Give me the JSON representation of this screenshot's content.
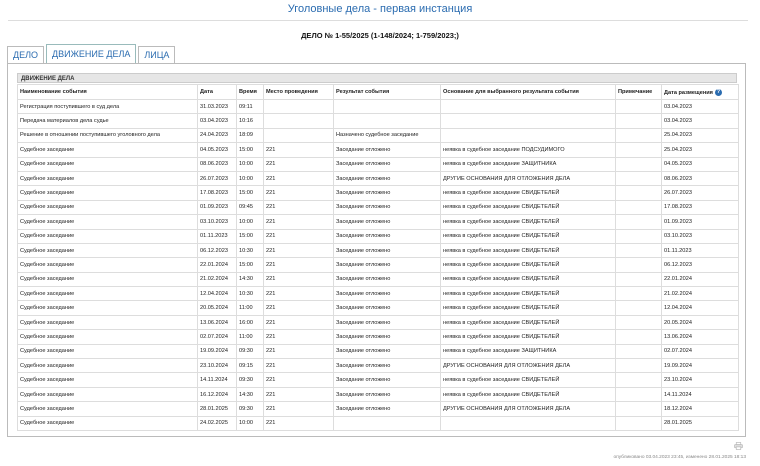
{
  "header": {
    "title": "Уголовные дела - первая инстанция",
    "case_number": "ДЕЛО № 1-55/2025 (1-148/2024; 1-759/2023;)"
  },
  "tabs": [
    {
      "label": "ДЕЛО"
    },
    {
      "label": "ДВИЖЕНИЕ ДЕЛА"
    },
    {
      "label": "ЛИЦА"
    }
  ],
  "section": {
    "title": "ДВИЖЕНИЕ ДЕЛА"
  },
  "columns": [
    "Наименование события",
    "Дата",
    "Время",
    "Место проведения",
    "Результат события",
    "Основание для выбранного результата события",
    "Примечание",
    "Дата размещения"
  ],
  "rows": [
    [
      "Регистрация поступившего в суд дела",
      "31.03.2023",
      "09:11",
      "",
      "",
      "",
      "",
      "03.04.2023"
    ],
    [
      "Передача материалов дела судье",
      "03.04.2023",
      "10:16",
      "",
      "",
      "",
      "",
      "03.04.2023"
    ],
    [
      "Решение в отношении поступившего уголовного дела",
      "24.04.2023",
      "18:09",
      "",
      "Назначено судебное заседание",
      "",
      "",
      "25.04.2023"
    ],
    [
      "Судебное заседание",
      "04.05.2023",
      "15:00",
      "221",
      "Заседание отложено",
      "неявка в судебное заседание ПОДСУДИМОГО",
      "",
      "25.04.2023"
    ],
    [
      "Судебное заседание",
      "08.06.2023",
      "10:00",
      "221",
      "Заседание отложено",
      "неявка в судебное заседание ЗАЩИТНИКА",
      "",
      "04.05.2023"
    ],
    [
      "Судебное заседание",
      "26.07.2023",
      "10:00",
      "221",
      "Заседание отложено",
      "ДРУГИЕ ОСНОВАНИЯ ДЛЯ ОТЛОЖЕНИЯ ДЕЛА",
      "",
      "08.06.2023"
    ],
    [
      "Судебное заседание",
      "17.08.2023",
      "15:00",
      "221",
      "Заседание отложено",
      "неявка в судебное заседание СВИДЕТЕЛЕЙ",
      "",
      "26.07.2023"
    ],
    [
      "Судебное заседание",
      "01.09.2023",
      "09:45",
      "221",
      "Заседание отложено",
      "неявка в судебное заседание СВИДЕТЕЛЕЙ",
      "",
      "17.08.2023"
    ],
    [
      "Судебное заседание",
      "03.10.2023",
      "10:00",
      "221",
      "Заседание отложено",
      "неявка в судебное заседание СВИДЕТЕЛЕЙ",
      "",
      "01.09.2023"
    ],
    [
      "Судебное заседание",
      "01.11.2023",
      "15:00",
      "221",
      "Заседание отложено",
      "неявка в судебное заседание СВИДЕТЕЛЕЙ",
      "",
      "03.10.2023"
    ],
    [
      "Судебное заседание",
      "06.12.2023",
      "10:30",
      "221",
      "Заседание отложено",
      "неявка в судебное заседание СВИДЕТЕЛЕЙ",
      "",
      "01.11.2023"
    ],
    [
      "Судебное заседание",
      "22.01.2024",
      "15:00",
      "221",
      "Заседание отложено",
      "неявка в судебное заседание СВИДЕТЕЛЕЙ",
      "",
      "06.12.2023"
    ],
    [
      "Судебное заседание",
      "21.02.2024",
      "14:30",
      "221",
      "Заседание отложено",
      "неявка в судебное заседание СВИДЕТЕЛЕЙ",
      "",
      "22.01.2024"
    ],
    [
      "Судебное заседание",
      "12.04.2024",
      "10:30",
      "221",
      "Заседание отложено",
      "неявка в судебное заседание СВИДЕТЕЛЕЙ",
      "",
      "21.02.2024"
    ],
    [
      "Судебное заседание",
      "20.05.2024",
      "11:00",
      "221",
      "Заседание отложено",
      "неявка в судебное заседание СВИДЕТЕЛЕЙ",
      "",
      "12.04.2024"
    ],
    [
      "Судебное заседание",
      "13.06.2024",
      "16:00",
      "221",
      "Заседание отложено",
      "неявка в судебное заседание СВИДЕТЕЛЕЙ",
      "",
      "20.05.2024"
    ],
    [
      "Судебное заседание",
      "02.07.2024",
      "11:00",
      "221",
      "Заседание отложено",
      "неявка в судебное заседание СВИДЕТЕЛЕЙ",
      "",
      "13.06.2024"
    ],
    [
      "Судебное заседание",
      "19.09.2024",
      "09:30",
      "221",
      "Заседание отложено",
      "неявка в судебное заседание ЗАЩИТНИКА",
      "",
      "02.07.2024"
    ],
    [
      "Судебное заседание",
      "23.10.2024",
      "09:15",
      "221",
      "Заседание отложено",
      "ДРУГИЕ ОСНОВАНИЯ ДЛЯ ОТЛОЖЕНИЯ ДЕЛА",
      "",
      "19.09.2024"
    ],
    [
      "Судебное заседание",
      "14.11.2024",
      "09:30",
      "221",
      "Заседание отложено",
      "неявка в судебное заседание СВИДЕТЕЛЕЙ",
      "",
      "23.10.2024"
    ],
    [
      "Судебное заседание",
      "16.12.2024",
      "14:30",
      "221",
      "Заседание отложено",
      "неявка в судебное заседание СВИДЕТЕЛЕЙ",
      "",
      "14.11.2024"
    ],
    [
      "Судебное заседание",
      "28.01.2025",
      "09:30",
      "221",
      "Заседание отложено",
      "ДРУГИЕ ОСНОВАНИЯ ДЛЯ ОТЛОЖЕНИЯ ДЕЛА",
      "",
      "18.12.2024"
    ],
    [
      "Судебное заседание",
      "24.02.2025",
      "10:00",
      "221",
      "",
      "",
      "",
      "28.01.2025"
    ]
  ],
  "footer": {
    "text": "опубликовано 03.04.2023 23:45, изменено 28.01.2025 18:13"
  },
  "icons": {
    "help": "help-icon",
    "print": "print-icon"
  },
  "colors": {
    "accent": "#2b6cb0",
    "section_bg": "#e6e6e6"
  }
}
